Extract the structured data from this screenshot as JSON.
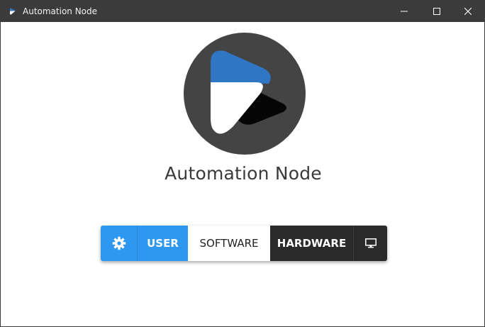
{
  "window": {
    "title": "Automation Node",
    "icons": {
      "app": "app-logo-icon",
      "minimize": "minimize-icon",
      "maximize": "maximize-icon",
      "close": "close-icon"
    }
  },
  "main": {
    "logo_icon": "play-logo",
    "app_name": "Automation Node"
  },
  "toolbar": {
    "settings_icon": "gear-icon",
    "user_label": "USER",
    "software_label": "SOFTWARE",
    "hardware_label": "HARDWARE",
    "display_icon": "monitor-icon"
  },
  "colors": {
    "accent": "#2e97ef",
    "dark": "#2a2a2a",
    "titlebar": "#3b3b3b",
    "logo_circle": "#444444",
    "logo_blue": "#2f77c4"
  }
}
